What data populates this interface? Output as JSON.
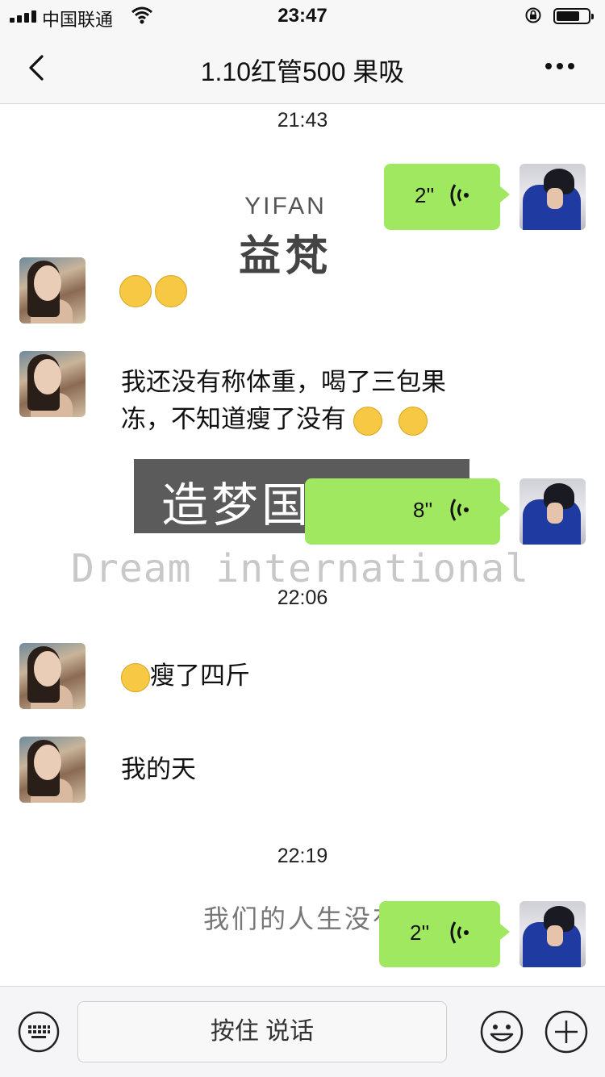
{
  "status_bar": {
    "carrier": "中国联通",
    "time": "23:47"
  },
  "nav": {
    "title": "1.10红管500 果吸"
  },
  "chat": {
    "timestamps": [
      "21:43",
      "22:06",
      "22:19"
    ],
    "voice_messages": [
      {
        "duration": "2''"
      },
      {
        "duration": "8''"
      },
      {
        "duration": "2''"
      }
    ],
    "text_messages": [
      {
        "line1": "我还没有称体重，喝了三包果",
        "line2": "冻，不知道瘦了没有"
      },
      {
        "text": "瘦了四斤"
      },
      {
        "text": "我的天"
      }
    ]
  },
  "watermarks": {
    "yifan_en": "YIFAN",
    "yifan_zh": "益梵",
    "dream_zh": "造梦国际",
    "dream_en": "Dream international",
    "slogan": "我们的人生没有退路可"
  },
  "input": {
    "hold_to_talk": "按住 说话"
  },
  "colors": {
    "bubble_right": "#9fe85f",
    "bar_bg": "#f7f7f7"
  }
}
